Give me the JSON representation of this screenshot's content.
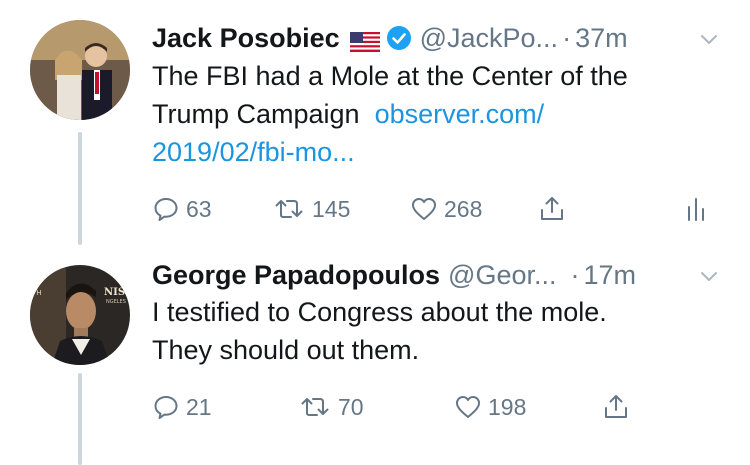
{
  "tweets": [
    {
      "author_name": "Jack Posobiec",
      "flag_icon": "us-flag-icon",
      "verified": true,
      "handle": "@JackPo...",
      "dot": "·",
      "time": "37m",
      "text_lines": [
        "The FBI had a Mole at the Center of the",
        "Trump Campaign"
      ],
      "link_part1": "observer.com/",
      "link_part2": "2019/02/fbi-mo...",
      "replies": "63",
      "retweets": "145",
      "likes": "268"
    },
    {
      "author_name": "George Papadopoulos",
      "handle": "@Geor...",
      "dot": "·",
      "time": "17m",
      "text_lines": [
        "I testified to Congress about the mole.",
        "They should out them."
      ],
      "replies": "21",
      "retweets": "70",
      "likes": "198"
    }
  ],
  "colors": {
    "text": "#14171a",
    "secondary": "#657786",
    "link": "#1b95e0",
    "verified": "#1da1f2",
    "thread_line": "#ccd6dd"
  }
}
